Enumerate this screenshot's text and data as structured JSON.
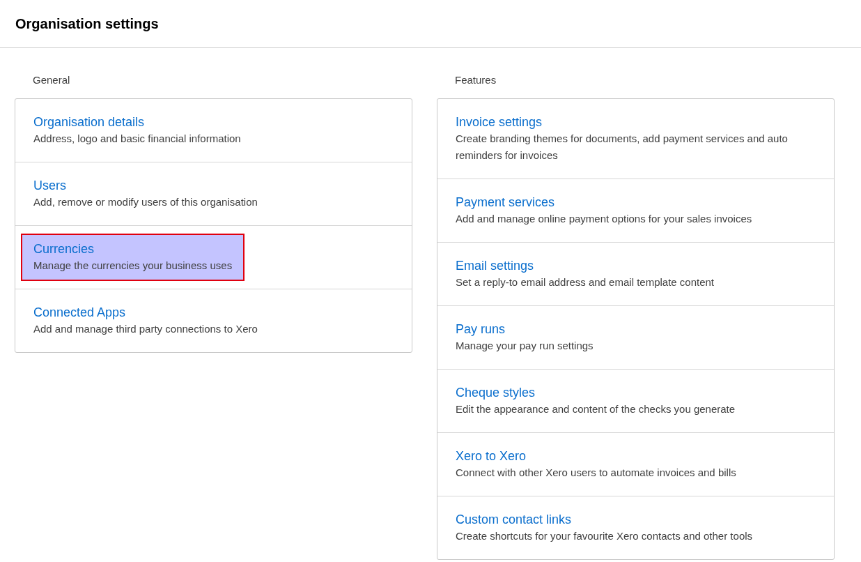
{
  "page": {
    "title": "Organisation settings"
  },
  "sections": [
    {
      "heading": "General",
      "items": [
        {
          "title": "Organisation details",
          "description": "Address, logo and basic financial information",
          "selected": false
        },
        {
          "title": "Users",
          "description": "Add, remove or modify users of this organisation",
          "selected": false
        },
        {
          "title": "Currencies",
          "description": "Manage the currencies your business uses",
          "selected": true
        },
        {
          "title": "Connected Apps",
          "description": "Add and manage third party connections to Xero",
          "selected": false
        }
      ]
    },
    {
      "heading": "Features",
      "items": [
        {
          "title": "Invoice settings",
          "description": "Create branding themes for documents, add payment services and auto reminders for invoices",
          "selected": false
        },
        {
          "title": "Payment services",
          "description": "Add and manage online payment options for your sales invoices",
          "selected": false
        },
        {
          "title": "Email settings",
          "description": "Set a reply-to email address and email template content",
          "selected": false
        },
        {
          "title": "Pay runs",
          "description": "Manage your pay run settings",
          "selected": false
        },
        {
          "title": "Cheque styles",
          "description": "Edit the appearance and content of the checks you generate",
          "selected": false
        },
        {
          "title": "Xero to Xero",
          "description": "Connect with other Xero users to automate invoices and bills",
          "selected": false
        },
        {
          "title": "Custom contact links",
          "description": "Create shortcuts for your favourite Xero contacts and other tools",
          "selected": false
        }
      ]
    }
  ]
}
